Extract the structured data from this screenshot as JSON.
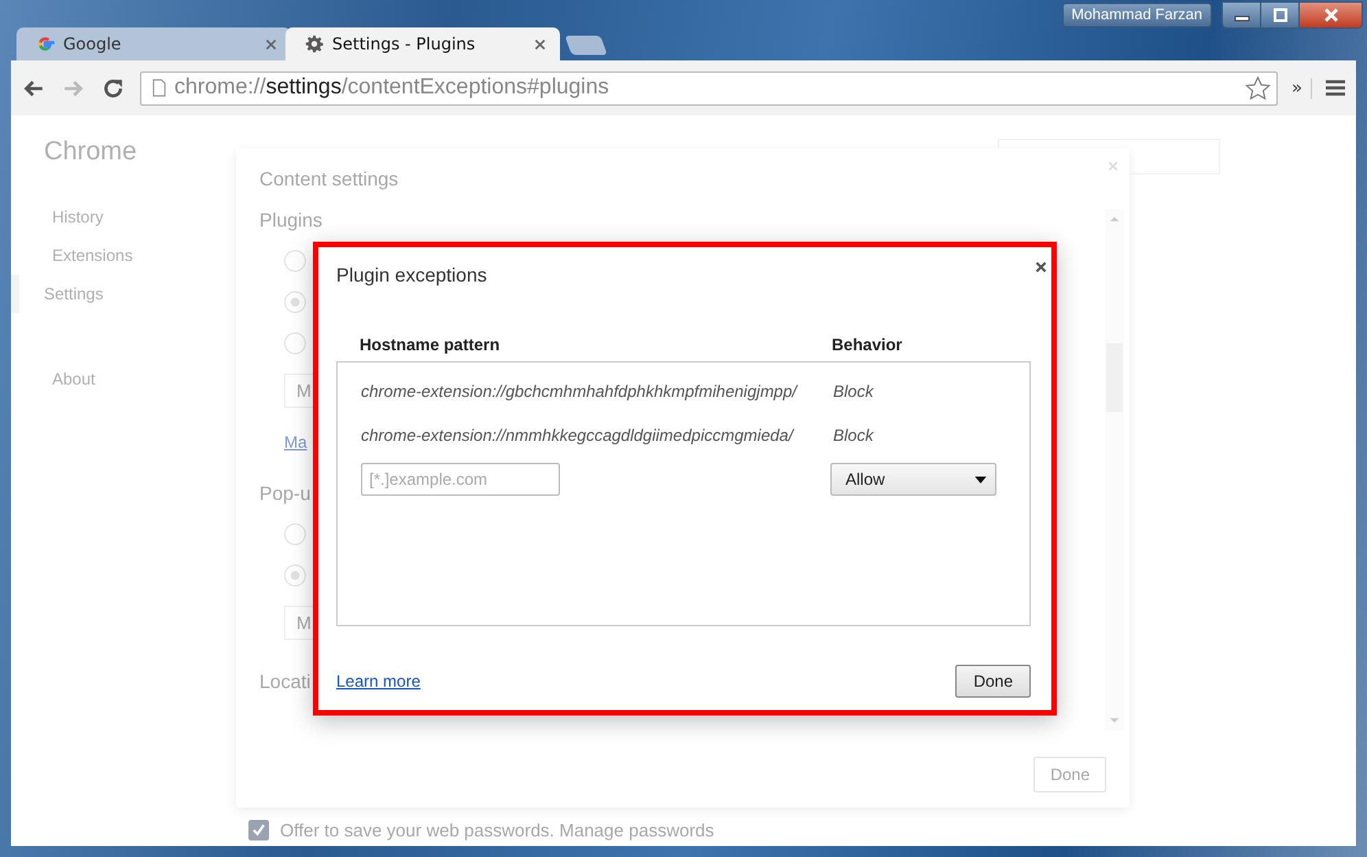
{
  "window": {
    "profile_name": "Mohammad Farzan"
  },
  "tabs": [
    {
      "title": "Google",
      "selected": false
    },
    {
      "title": "Settings - Plugins",
      "selected": true
    }
  ],
  "toolbar": {
    "forward_disabled": true,
    "url": {
      "scheme": "chrome://",
      "host": "settings",
      "path": "/contentExceptions#plugins"
    },
    "overflow": "»"
  },
  "sidebar": {
    "title": "Chrome",
    "items": [
      {
        "label": "History",
        "selected": false
      },
      {
        "label": "Extensions",
        "selected": false
      },
      {
        "label": "Settings",
        "selected": true
      },
      {
        "label": "About",
        "selected": false
      }
    ]
  },
  "settings_page": {
    "checkbox": {
      "label": "Offer to save your web passwords. Manage passwords",
      "checked": true
    }
  },
  "content_settings": {
    "title": "Content settings",
    "sections": [
      {
        "title": "Plugins",
        "radios": [
          {
            "selected": false
          },
          {
            "selected": true
          },
          {
            "selected": false
          }
        ],
        "button": "M",
        "link": "Ma"
      },
      {
        "title": "Pop-u",
        "radios": [
          {
            "selected": false
          },
          {
            "selected": true
          }
        ],
        "button": "M"
      },
      {
        "title": "Locati"
      }
    ],
    "done_button": "Done",
    "done_disabled": true
  },
  "dialog": {
    "title": "Plugin exceptions",
    "columns": [
      "Hostname pattern",
      "Behavior"
    ],
    "rows": [
      {
        "pattern": "chrome-extension://gbchcmhmhahfdphkhkmpfmihenigjmpp/",
        "behavior": "Block"
      },
      {
        "pattern": "chrome-extension://nmmhkkegccagdldgiimedpiccmgmieda/",
        "behavior": "Block"
      }
    ],
    "new_row": {
      "placeholder": "[*.]example.com",
      "behavior": "Allow"
    },
    "learn_more": "Learn more",
    "done_button": "Done"
  }
}
